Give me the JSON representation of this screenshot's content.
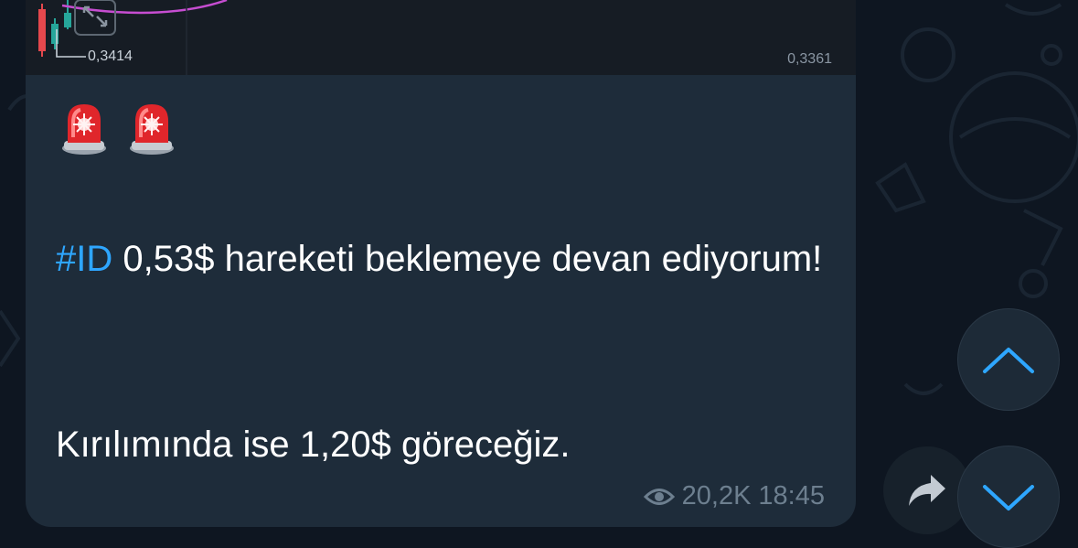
{
  "chart_preview": {
    "price_left": "0,3414",
    "price_right": "0,3361"
  },
  "message": {
    "emojis": [
      "siren",
      "siren"
    ],
    "hashtag": "#ID",
    "line1_rest": " 0,53$ hareketi beklemeye devan ediyorum!",
    "line2": "Kırılımında ise 1,20$ göreceğiz.",
    "views": "20,2K",
    "time": "18:45"
  },
  "colors": {
    "background": "#0e1621",
    "bubble": "#1e2c3a",
    "link": "#2ea6ff",
    "meta": "#6d7f8f"
  },
  "icons": {
    "share": "share-arrow-icon",
    "scroll_up": "chevron-up-icon",
    "scroll_down": "chevron-down-icon",
    "views": "eye-icon"
  }
}
